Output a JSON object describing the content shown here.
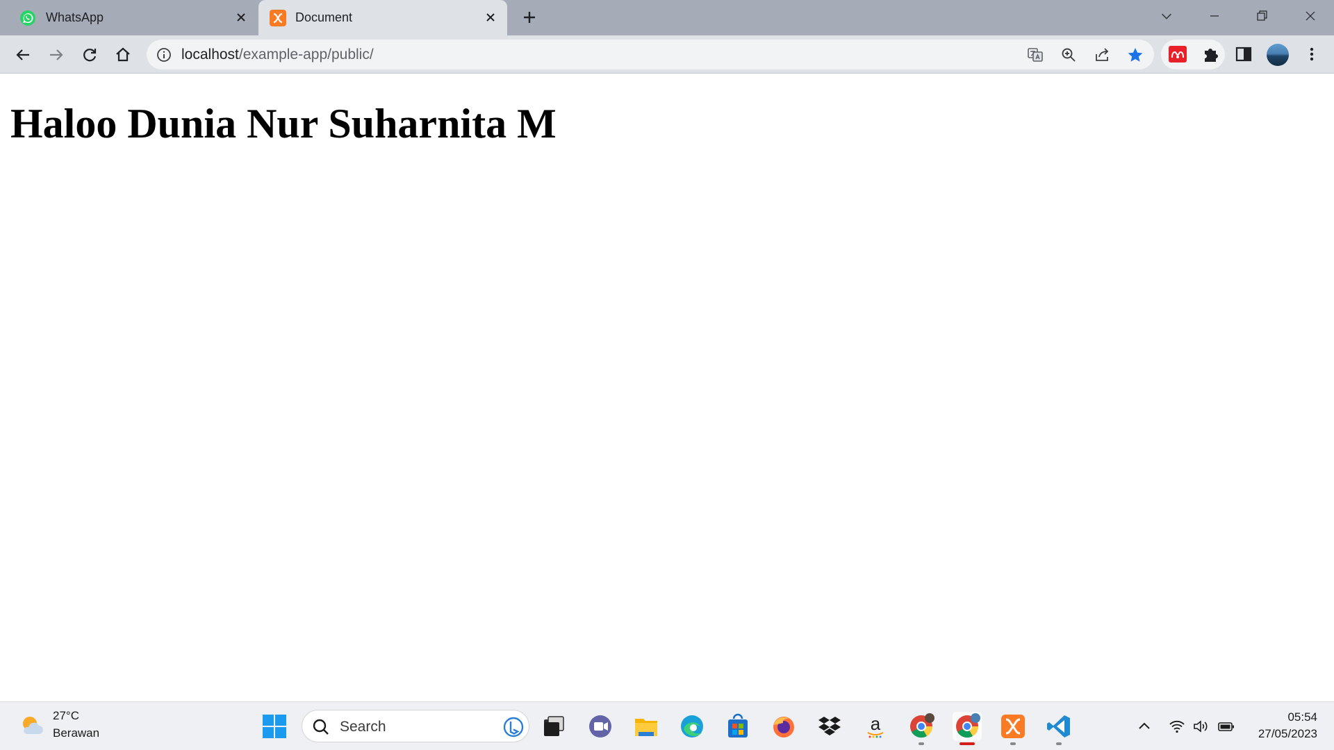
{
  "browser": {
    "tabs": [
      {
        "title": "WhatsApp",
        "active": false
      },
      {
        "title": "Document",
        "active": true
      }
    ],
    "address": {
      "host": "localhost",
      "path": "/example-app/public/"
    }
  },
  "page": {
    "heading": "Haloo Dunia Nur Suharnita M"
  },
  "taskbar": {
    "weather": {
      "temp": "27°C",
      "condition": "Berawan"
    },
    "search_placeholder": "Search",
    "clock": {
      "time": "05:54",
      "date": "27/05/2023"
    }
  },
  "colors": {
    "tabstrip": "#a6abb8",
    "toolbar": "#dee1e6",
    "bookmark_star": "#1a73e8",
    "taskbar": "#eef0f3"
  }
}
